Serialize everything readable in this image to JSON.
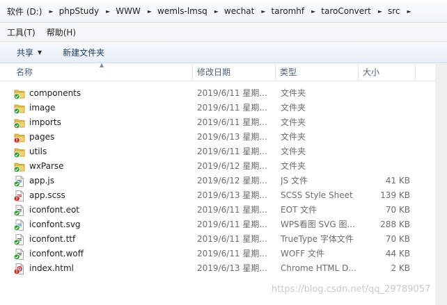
{
  "breadcrumb": {
    "items": [
      "软件 (D:)",
      "phpStudy",
      "WWW",
      "wemls-lmsq",
      "wechat",
      "taromhf",
      "taroConvert",
      "src"
    ]
  },
  "menu": {
    "items": [
      "工具(T)",
      "帮助(H)"
    ]
  },
  "toolbar": {
    "share_label": "共享",
    "new_folder_label": "新建文件夹"
  },
  "columns": {
    "name": "名称",
    "date": "修改日期",
    "type": "类型",
    "size": "大小"
  },
  "files": [
    {
      "name": "components",
      "date": "2019/6/11 星期...",
      "type": "文件夹",
      "size": "",
      "icon": "folder-sync-ok-icon"
    },
    {
      "name": "image",
      "date": "2019/6/11 星期...",
      "type": "文件夹",
      "size": "",
      "icon": "folder-sync-ok-icon"
    },
    {
      "name": "imports",
      "date": "2019/6/11 星期...",
      "type": "文件夹",
      "size": "",
      "icon": "folder-sync-ok-icon"
    },
    {
      "name": "pages",
      "date": "2019/6/13 星期...",
      "type": "文件夹",
      "size": "",
      "icon": "folder-modified-icon"
    },
    {
      "name": "utils",
      "date": "2019/6/11 星期...",
      "type": "文件夹",
      "size": "",
      "icon": "folder-sync-ok-icon"
    },
    {
      "name": "wxParse",
      "date": "2019/6/12 星期...",
      "type": "文件夹",
      "size": "",
      "icon": "folder-sync-ok-icon"
    },
    {
      "name": "app.js",
      "date": "2019/6/12 星期...",
      "type": "JS 文件",
      "size": "41 KB",
      "icon": "js-file-sync-ok-icon"
    },
    {
      "name": "app.scss",
      "date": "2019/6/13 星期...",
      "type": "SCSS Style Sheet",
      "size": "139 KB",
      "icon": "scss-file-modified-icon"
    },
    {
      "name": "iconfont.eot",
      "date": "2019/6/11 星期...",
      "type": "EOT 文件",
      "size": "70 KB",
      "icon": "eot-file-sync-ok-icon"
    },
    {
      "name": "iconfont.svg",
      "date": "2019/6/11 星期...",
      "type": "WPS看图 SVG 图...",
      "size": "288 KB",
      "icon": "svg-file-sync-ok-icon"
    },
    {
      "name": "iconfont.ttf",
      "date": "2019/6/11 星期...",
      "type": "TrueType 字体文件",
      "size": "70 KB",
      "icon": "ttf-file-sync-ok-icon"
    },
    {
      "name": "iconfont.woff",
      "date": "2019/6/11 星期...",
      "type": "WOFF 文件",
      "size": "44 KB",
      "icon": "woff-file-sync-ok-icon"
    },
    {
      "name": "index.html",
      "date": "2019/6/13 星期...",
      "type": "Chrome HTML D...",
      "size": "2 KB",
      "icon": "html-file-modified-icon"
    }
  ],
  "watermark": "https://blog.csdn.net/qq_29789057",
  "colors": {
    "sync_ok": "#2e9e2e",
    "modified": "#d9241c",
    "folder": "#e8c34a"
  }
}
